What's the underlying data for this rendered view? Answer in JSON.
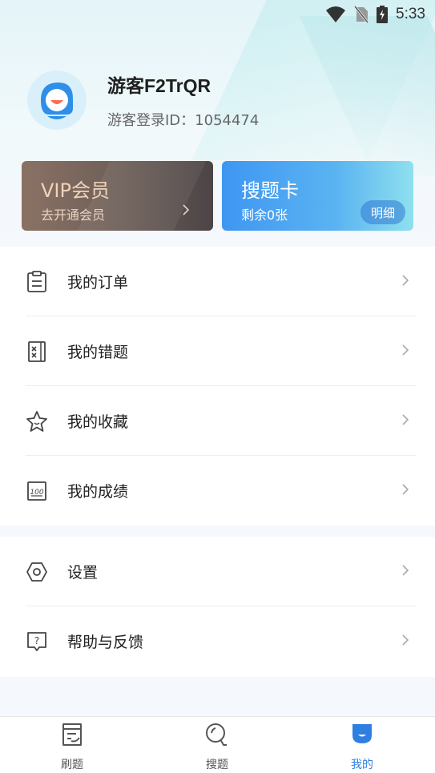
{
  "status_bar": {
    "time": "5:33",
    "icons": [
      "wifi-icon",
      "no-sim-icon",
      "battery-charging-icon"
    ]
  },
  "profile": {
    "username": "游客F2TrQR",
    "id_text": "游客登录ID：1054474"
  },
  "vip_card": {
    "title": "VIP会员",
    "subtitle": "去开通会员"
  },
  "search_card": {
    "title": "搜题卡",
    "subtitle": "剩余0张",
    "detail_label": "明细"
  },
  "menu_group1": [
    {
      "label": "我的订单",
      "icon": "clipboard-icon"
    },
    {
      "label": "我的错题",
      "icon": "wrong-question-icon"
    },
    {
      "label": "我的收藏",
      "icon": "star-icon"
    },
    {
      "label": "我的成绩",
      "icon": "score-100-icon"
    }
  ],
  "menu_group2": [
    {
      "label": "设置",
      "icon": "settings-hexagon-icon"
    },
    {
      "label": "帮助与反馈",
      "icon": "help-chat-icon"
    }
  ],
  "tabs": [
    {
      "label": "刷题",
      "icon": "practice-icon",
      "active": false
    },
    {
      "label": "搜题",
      "icon": "search-icon",
      "active": false
    },
    {
      "label": "我的",
      "icon": "profile-icon",
      "active": true
    }
  ],
  "colors": {
    "accent": "#2f7fe0",
    "vip_text": "#f0d3b8"
  }
}
